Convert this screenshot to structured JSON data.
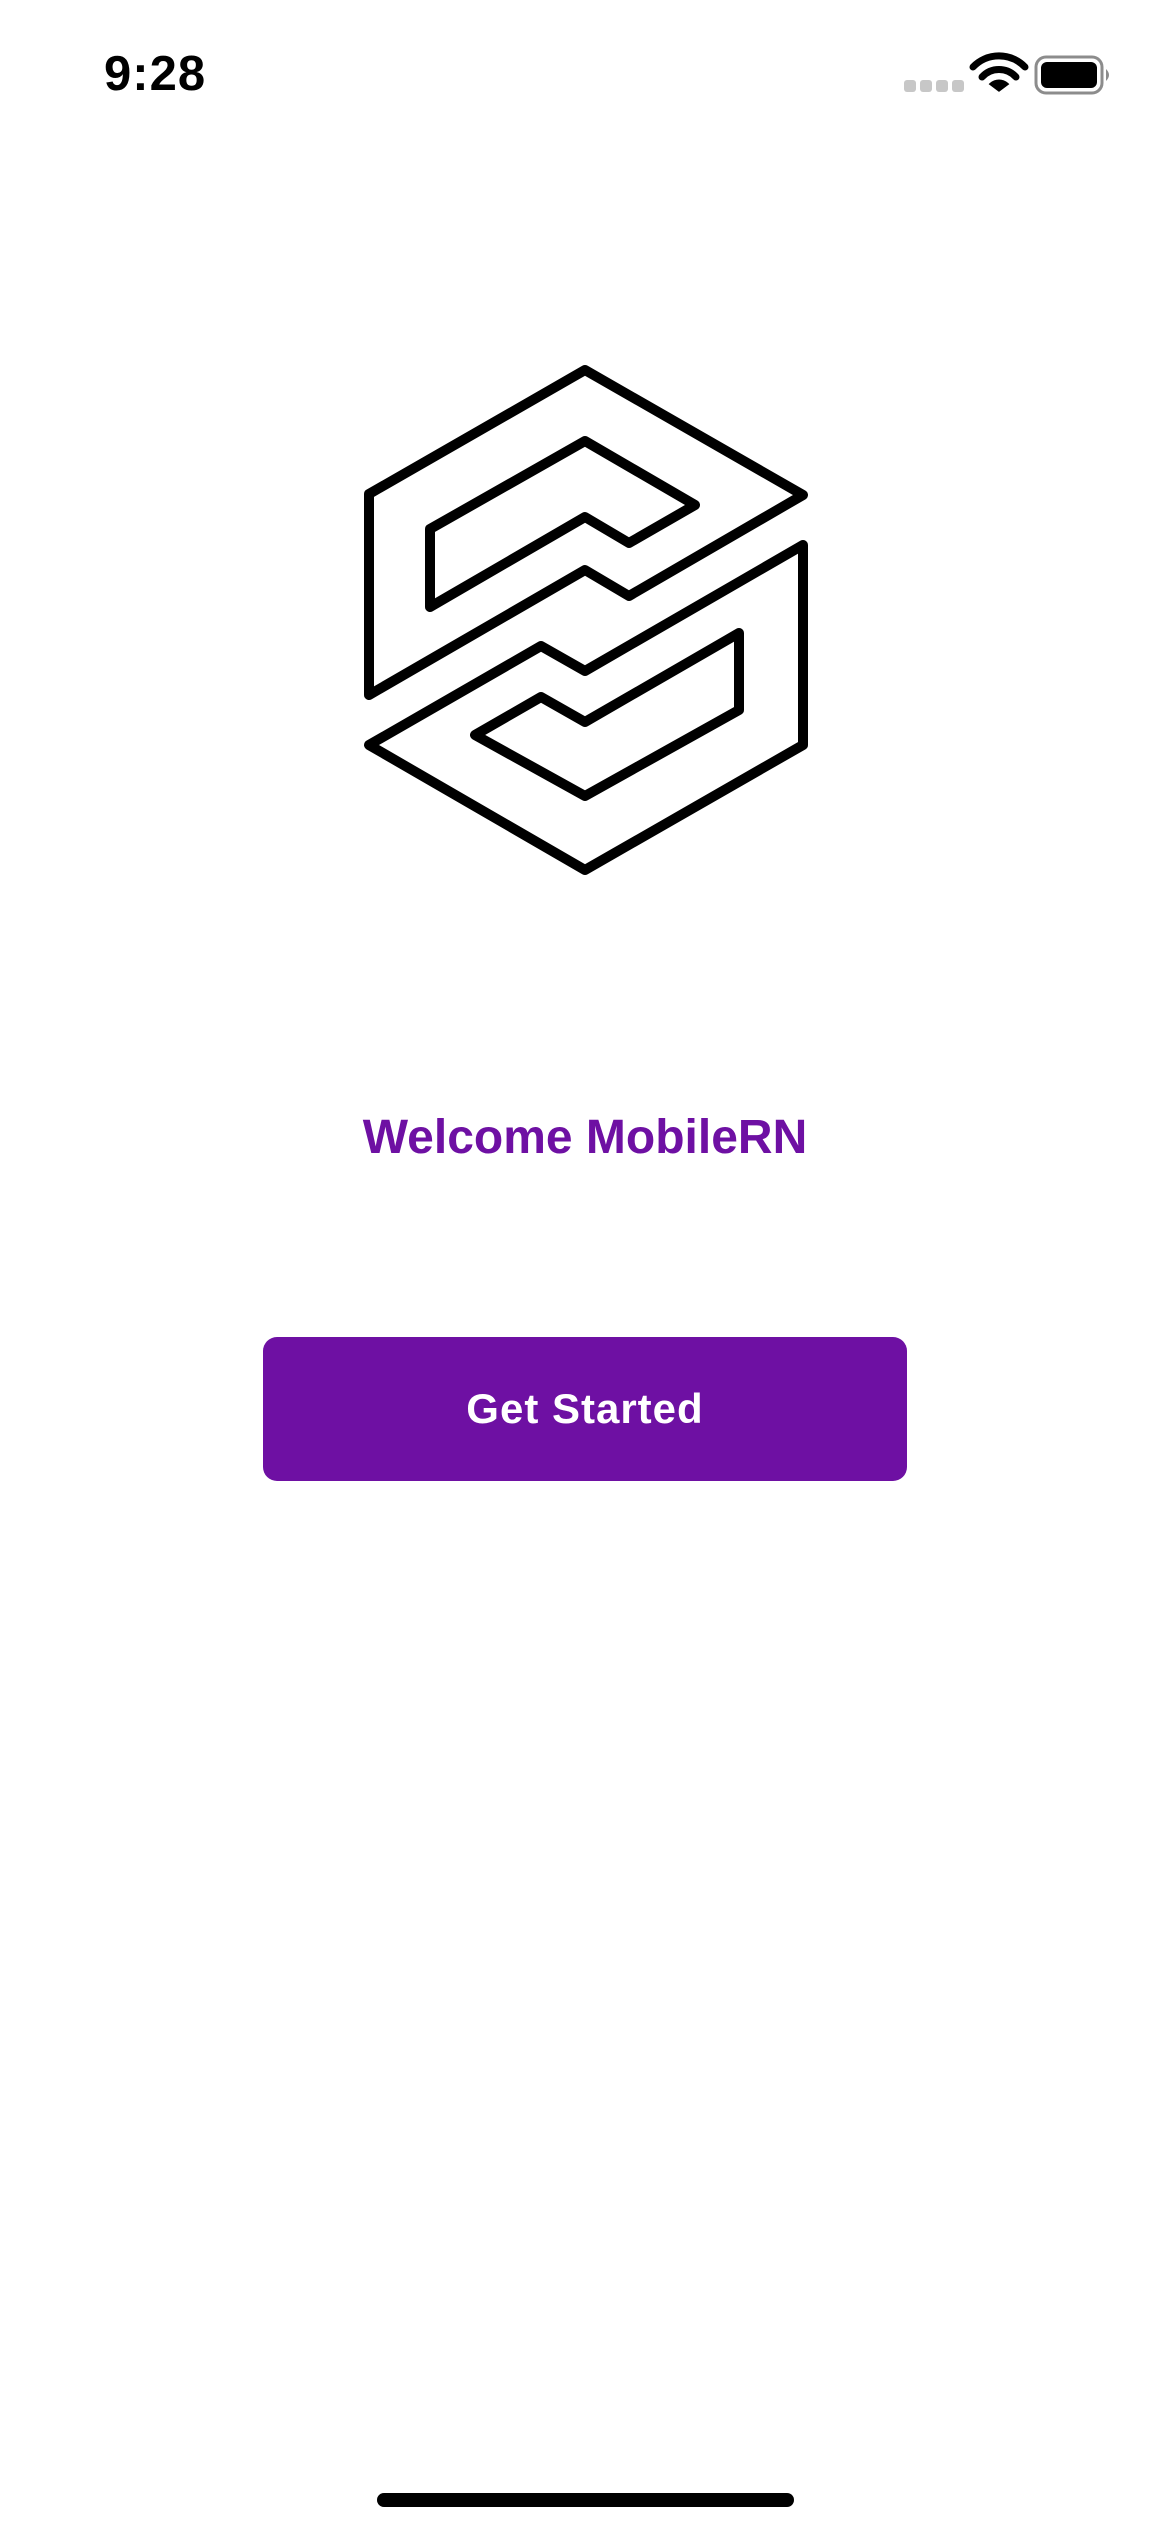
{
  "status_bar": {
    "time": "9:28",
    "icons": [
      "signal-icon",
      "wifi-icon",
      "battery-icon"
    ]
  },
  "logo": {
    "icon": "hexagon-s-logo-icon",
    "stroke_color": "#000000"
  },
  "welcome": {
    "title": "Welcome MobileRN"
  },
  "actions": {
    "get_started_label": "Get Started"
  },
  "colors": {
    "accent": "#6e10a3",
    "background": "#ffffff",
    "button_text": "#ffffff"
  }
}
